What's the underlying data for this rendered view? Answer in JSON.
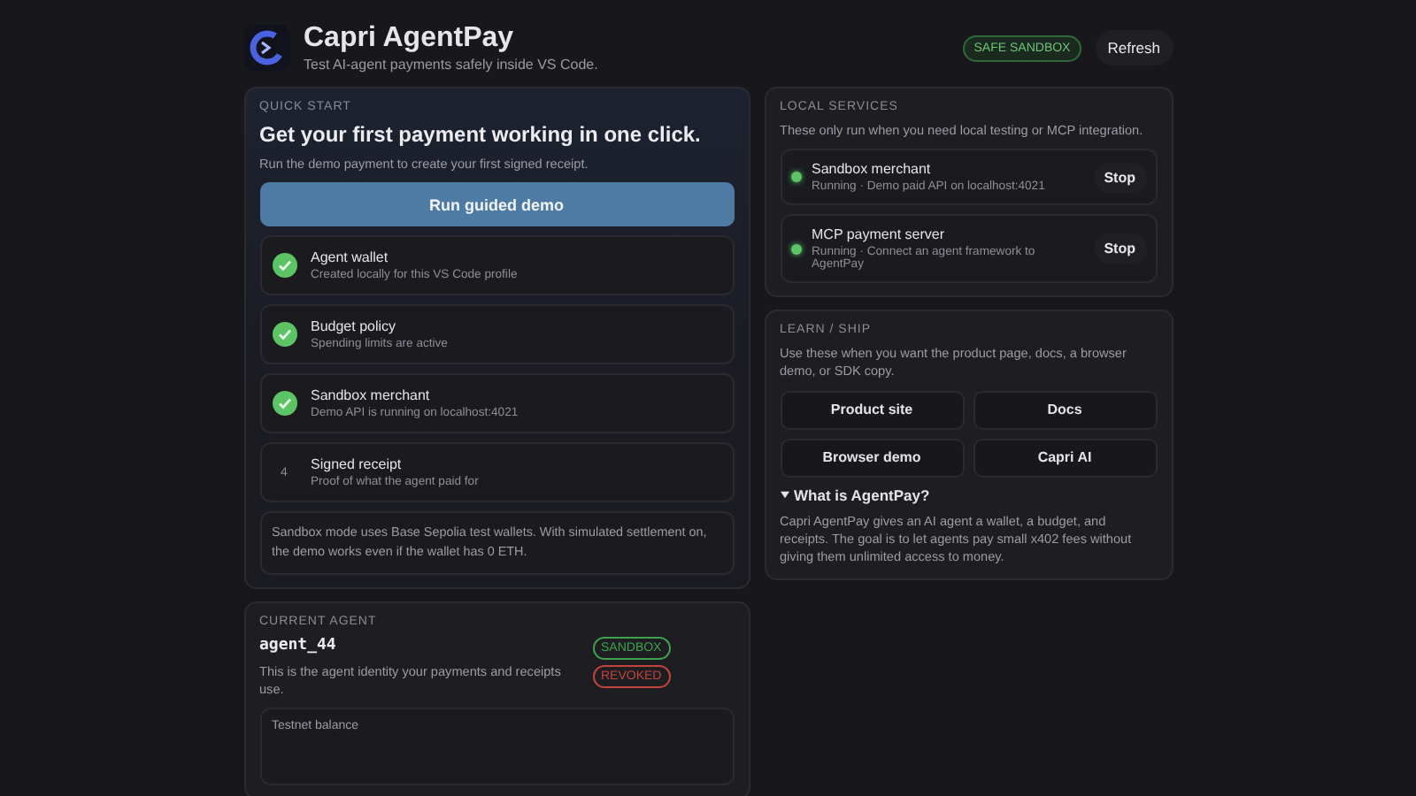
{
  "header": {
    "title": "Capri AgentPay",
    "subtitle": "Test AI-agent payments safely inside VS Code.",
    "badge": "SAFE SANDBOX",
    "refresh": "Refresh"
  },
  "quick_start": {
    "heading": "QUICK START",
    "title": "Get your first payment working in one click.",
    "text": "Run the demo payment to create your first signed receipt.",
    "button": "Run guided demo",
    "steps": [
      {
        "title": "Agent wallet",
        "detail": "Created locally for this VS Code profile",
        "done": true
      },
      {
        "title": "Budget policy",
        "detail": "Spending limits are active",
        "done": true
      },
      {
        "title": "Sandbox merchant",
        "detail": "Demo API is running on localhost:4021",
        "done": true
      },
      {
        "title": "Signed receipt",
        "detail": "Proof of what the agent paid for",
        "done": false,
        "number": "4"
      }
    ],
    "note": "Sandbox mode uses Base Sepolia test wallets. With simulated settlement on, the demo works even if the wallet has 0 ETH."
  },
  "current_agent": {
    "heading": "CURRENT AGENT",
    "name": "agent_44",
    "text": "This is the agent identity your payments and receipts use.",
    "tags": [
      {
        "label": "SANDBOX",
        "color": "#3fa34d"
      },
      {
        "label": "REVOKED",
        "color": "#c0453a"
      }
    ],
    "balance_label": "Testnet balance"
  },
  "local_services": {
    "heading": "LOCAL SERVICES",
    "text": "These only run when you need local testing or MCP integration.",
    "services": [
      {
        "name": "Sandbox merchant",
        "status": "Running · Demo paid API on localhost:4021",
        "running": true,
        "button": "Stop"
      },
      {
        "name": "MCP payment server",
        "status": "Running · Connect an agent framework to AgentPay",
        "running": true,
        "button": "Stop"
      }
    ]
  },
  "learn": {
    "heading": "LEARN / SHIP",
    "text": "Use these when you want the product page, docs, a browser demo, or SDK copy.",
    "links": [
      "Product site",
      "Docs",
      "Browser demo",
      "Capri AI"
    ],
    "faq": {
      "title": "What is AgentPay?",
      "expanded": true,
      "answer": "Capri AgentPay gives an AI agent a wallet, a budget, and receipts. The goal is to let agents pay small x402 fees without giving them unlimited access to money."
    }
  }
}
